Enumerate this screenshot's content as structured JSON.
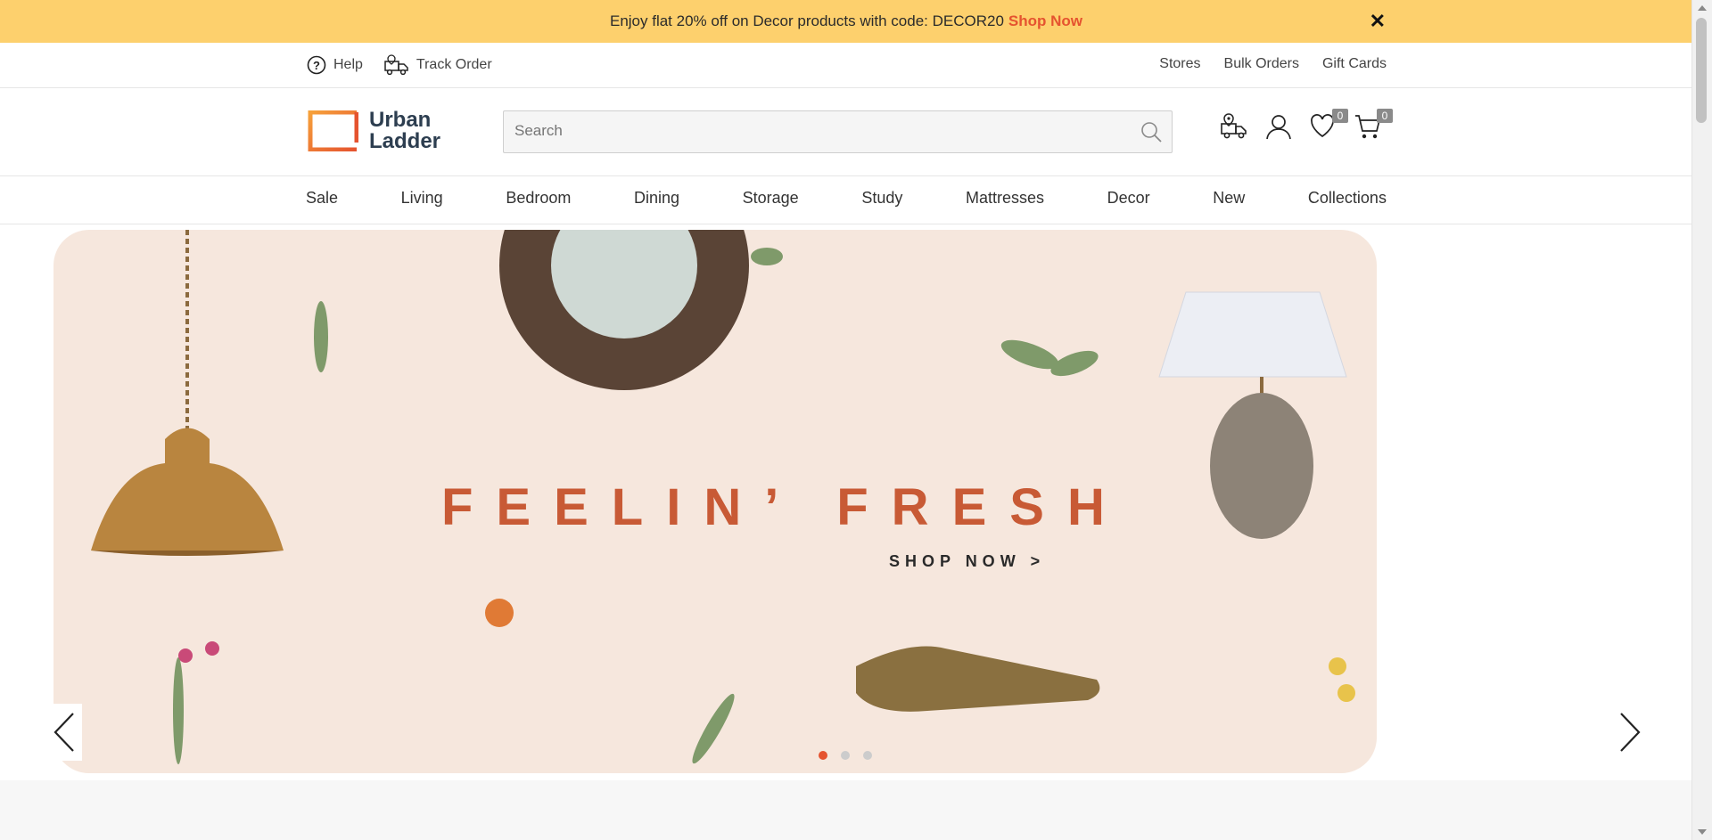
{
  "promo": {
    "text": "Enjoy flat 20% off on Decor products with code: DECOR20",
    "link": "Shop Now",
    "close_icon": "close-icon",
    "background": "#fdd06d",
    "link_color": "#e5532f"
  },
  "util": {
    "help": "Help",
    "track_order": "Track Order",
    "stores": "Stores",
    "bulk_orders": "Bulk Orders",
    "gift_cards": "Gift Cards"
  },
  "header": {
    "logo_line1": "Urban",
    "logo_line2": "Ladder",
    "search_placeholder": "Search",
    "wishlist_count": "0",
    "cart_count": "0",
    "icons": [
      "store-locator-icon",
      "account-icon",
      "wishlist-icon",
      "cart-icon"
    ]
  },
  "nav": {
    "items": [
      "Sale",
      "Living",
      "Bedroom",
      "Dining",
      "Storage",
      "Study",
      "Mattresses",
      "Decor",
      "New",
      "Collections"
    ]
  },
  "hero": {
    "headline": "FEELIN’ FRESH",
    "cta": "SHOP NOW >",
    "slides": 3,
    "active_slide": 1,
    "accent": "#c85a35"
  }
}
